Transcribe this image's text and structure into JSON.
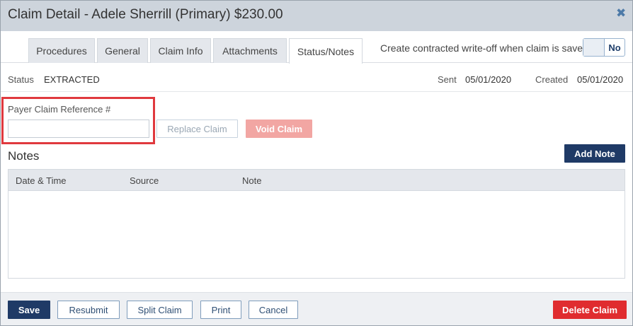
{
  "dialog": {
    "title": "Claim Detail - Adele Sherrill (Primary) $230.00",
    "close_icon": "close-icon"
  },
  "tabs": [
    {
      "label": "Procedures",
      "active": false
    },
    {
      "label": "General",
      "active": false
    },
    {
      "label": "Claim Info",
      "active": false
    },
    {
      "label": "Attachments",
      "active": false
    },
    {
      "label": "Status/Notes",
      "active": true
    }
  ],
  "writeoff": {
    "label": "Create contracted write-off when claim is saved",
    "toggle_value": "No"
  },
  "status": {
    "status_label": "Status",
    "status_value": "EXTRACTED",
    "sent_label": "Sent",
    "sent_value": "05/01/2020",
    "created_label": "Created",
    "created_value": "05/01/2020"
  },
  "payer": {
    "label": "Payer Claim Reference #",
    "value": "",
    "placeholder": ""
  },
  "actions": {
    "replace_claim": "Replace Claim",
    "void_claim": "Void Claim"
  },
  "notes": {
    "title": "Notes",
    "add_note": "Add Note",
    "columns": [
      "Date & Time",
      "Source",
      "Note"
    ],
    "rows": []
  },
  "footer": {
    "save": "Save",
    "resubmit": "Resubmit",
    "split_claim": "Split Claim",
    "print": "Print",
    "cancel": "Cancel",
    "delete_claim": "Delete Claim"
  },
  "colors": {
    "primary": "#1f3a66",
    "danger": "#e02c2f",
    "highlight_box": "#e0393e",
    "title_bar": "#cdd4dc"
  }
}
